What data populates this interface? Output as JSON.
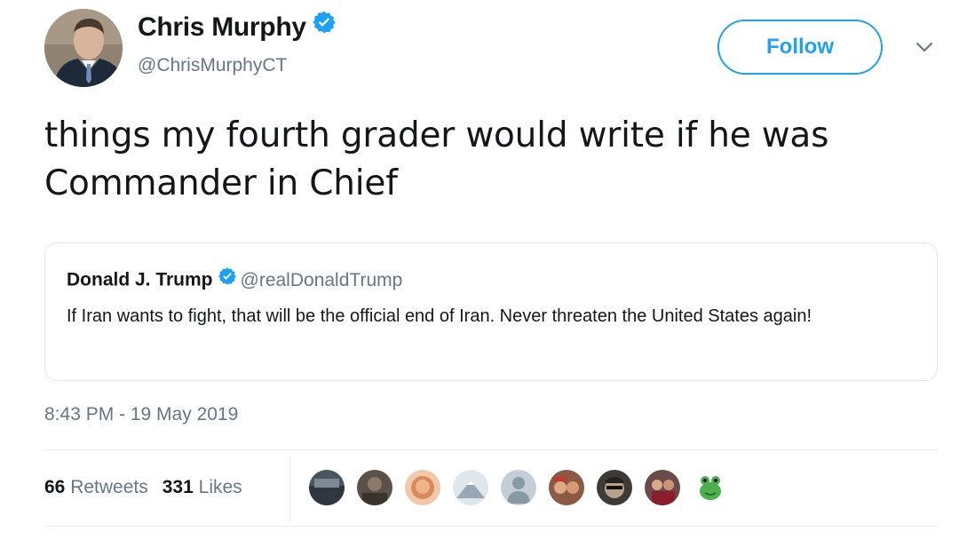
{
  "author": {
    "name": "Chris Murphy",
    "handle": "@ChrisMurphyCT",
    "verified": true,
    "avatar_icon": "avatar-man-suit-icon"
  },
  "follow_button": {
    "label": "Follow"
  },
  "menu_icon": "chevron-down-icon",
  "tweet": {
    "text": "things my fourth grader would write if he was Commander in Chief",
    "timestamp": "8:43 PM - 19 May 2019"
  },
  "quoted_tweet": {
    "name": "Donald J. Trump",
    "handle": "@realDonaldTrump",
    "verified": true,
    "text": "If Iran wants to fight, that will be the official end of Iran. Never threaten the United States again!"
  },
  "stats": {
    "retweets_count": "66",
    "retweets_label": "Retweets",
    "likes_count": "331",
    "likes_label": "Likes"
  },
  "likers": [
    {
      "icon": "liker-avatar-icon",
      "color": "#4a5560"
    },
    {
      "icon": "liker-avatar-icon",
      "color": "#5b5148"
    },
    {
      "icon": "liker-avatar-icon",
      "color": "#d98a5a"
    },
    {
      "icon": "liker-avatar-icon",
      "color": "#9aa7b2"
    },
    {
      "icon": "default-avatar-icon",
      "color": "#c5ced6"
    },
    {
      "icon": "liker-avatar-icon",
      "color": "#8a5a44"
    },
    {
      "icon": "liker-avatar-icon",
      "color": "#3e3a36"
    },
    {
      "icon": "liker-avatar-icon",
      "color": "#6b4a4a"
    },
    {
      "icon": "frog-avatar-icon",
      "color": "#4caf50"
    }
  ],
  "colors": {
    "accent": "#1da1f2",
    "text_primary": "#14171a",
    "text_secondary": "#657786",
    "border": "#e1e8ed"
  }
}
